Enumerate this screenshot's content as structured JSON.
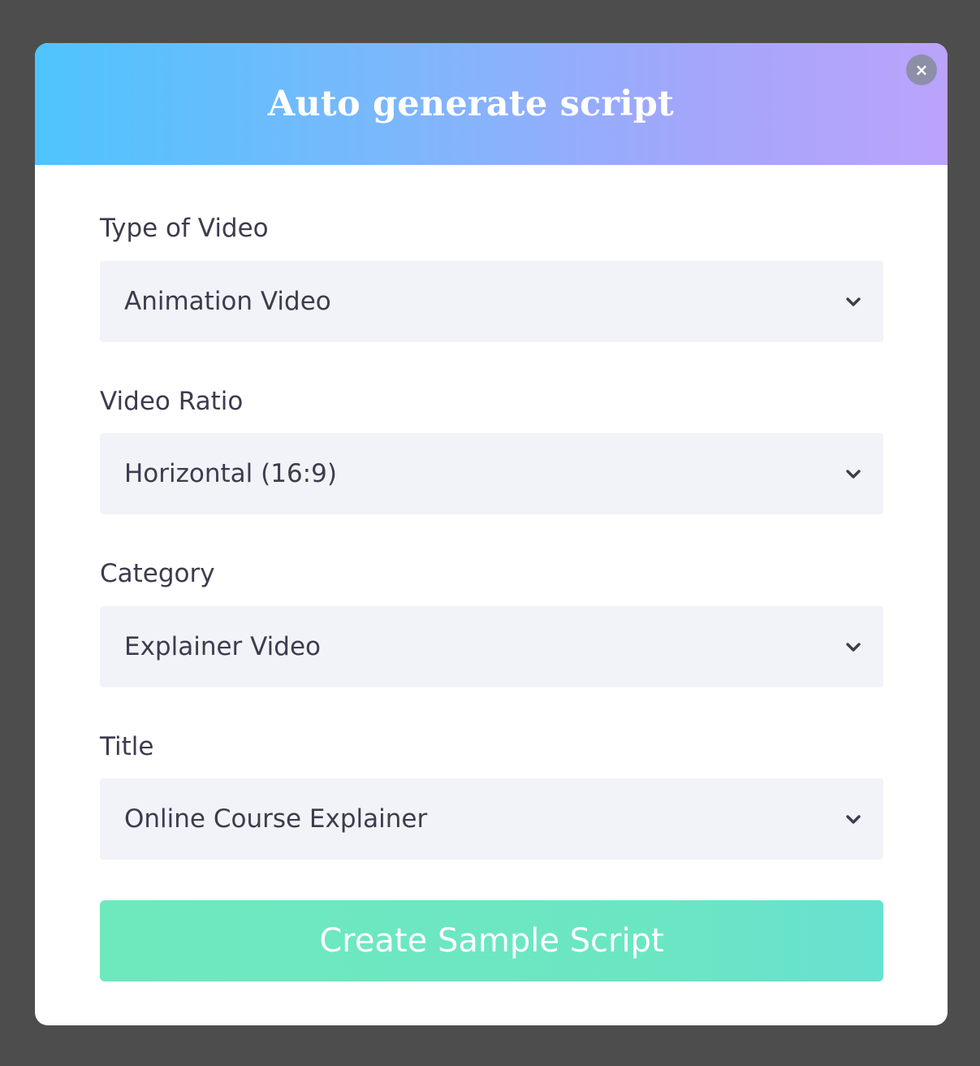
{
  "dialog": {
    "title": "Auto generate script",
    "close_label": "×"
  },
  "fields": [
    {
      "label": "Type of Video",
      "value": "Animation Video"
    },
    {
      "label": "Video Ratio",
      "value": "Horizontal (16:9)"
    },
    {
      "label": "Category",
      "value": "Explainer Video"
    },
    {
      "label": "Title",
      "value": "Online Course Explainer"
    }
  ],
  "submit": {
    "label": "Create Sample Script"
  },
  "icons": {
    "close": "close-icon",
    "dropdown": "chevron-down-icon"
  },
  "colors": {
    "header_gradient_start": "#4ec4fd",
    "header_gradient_end": "#bba3fb",
    "button": "#6ee9be",
    "field_background": "#f2f3f8",
    "text": "#3c3c4e",
    "backdrop": "#4d4d4d"
  }
}
